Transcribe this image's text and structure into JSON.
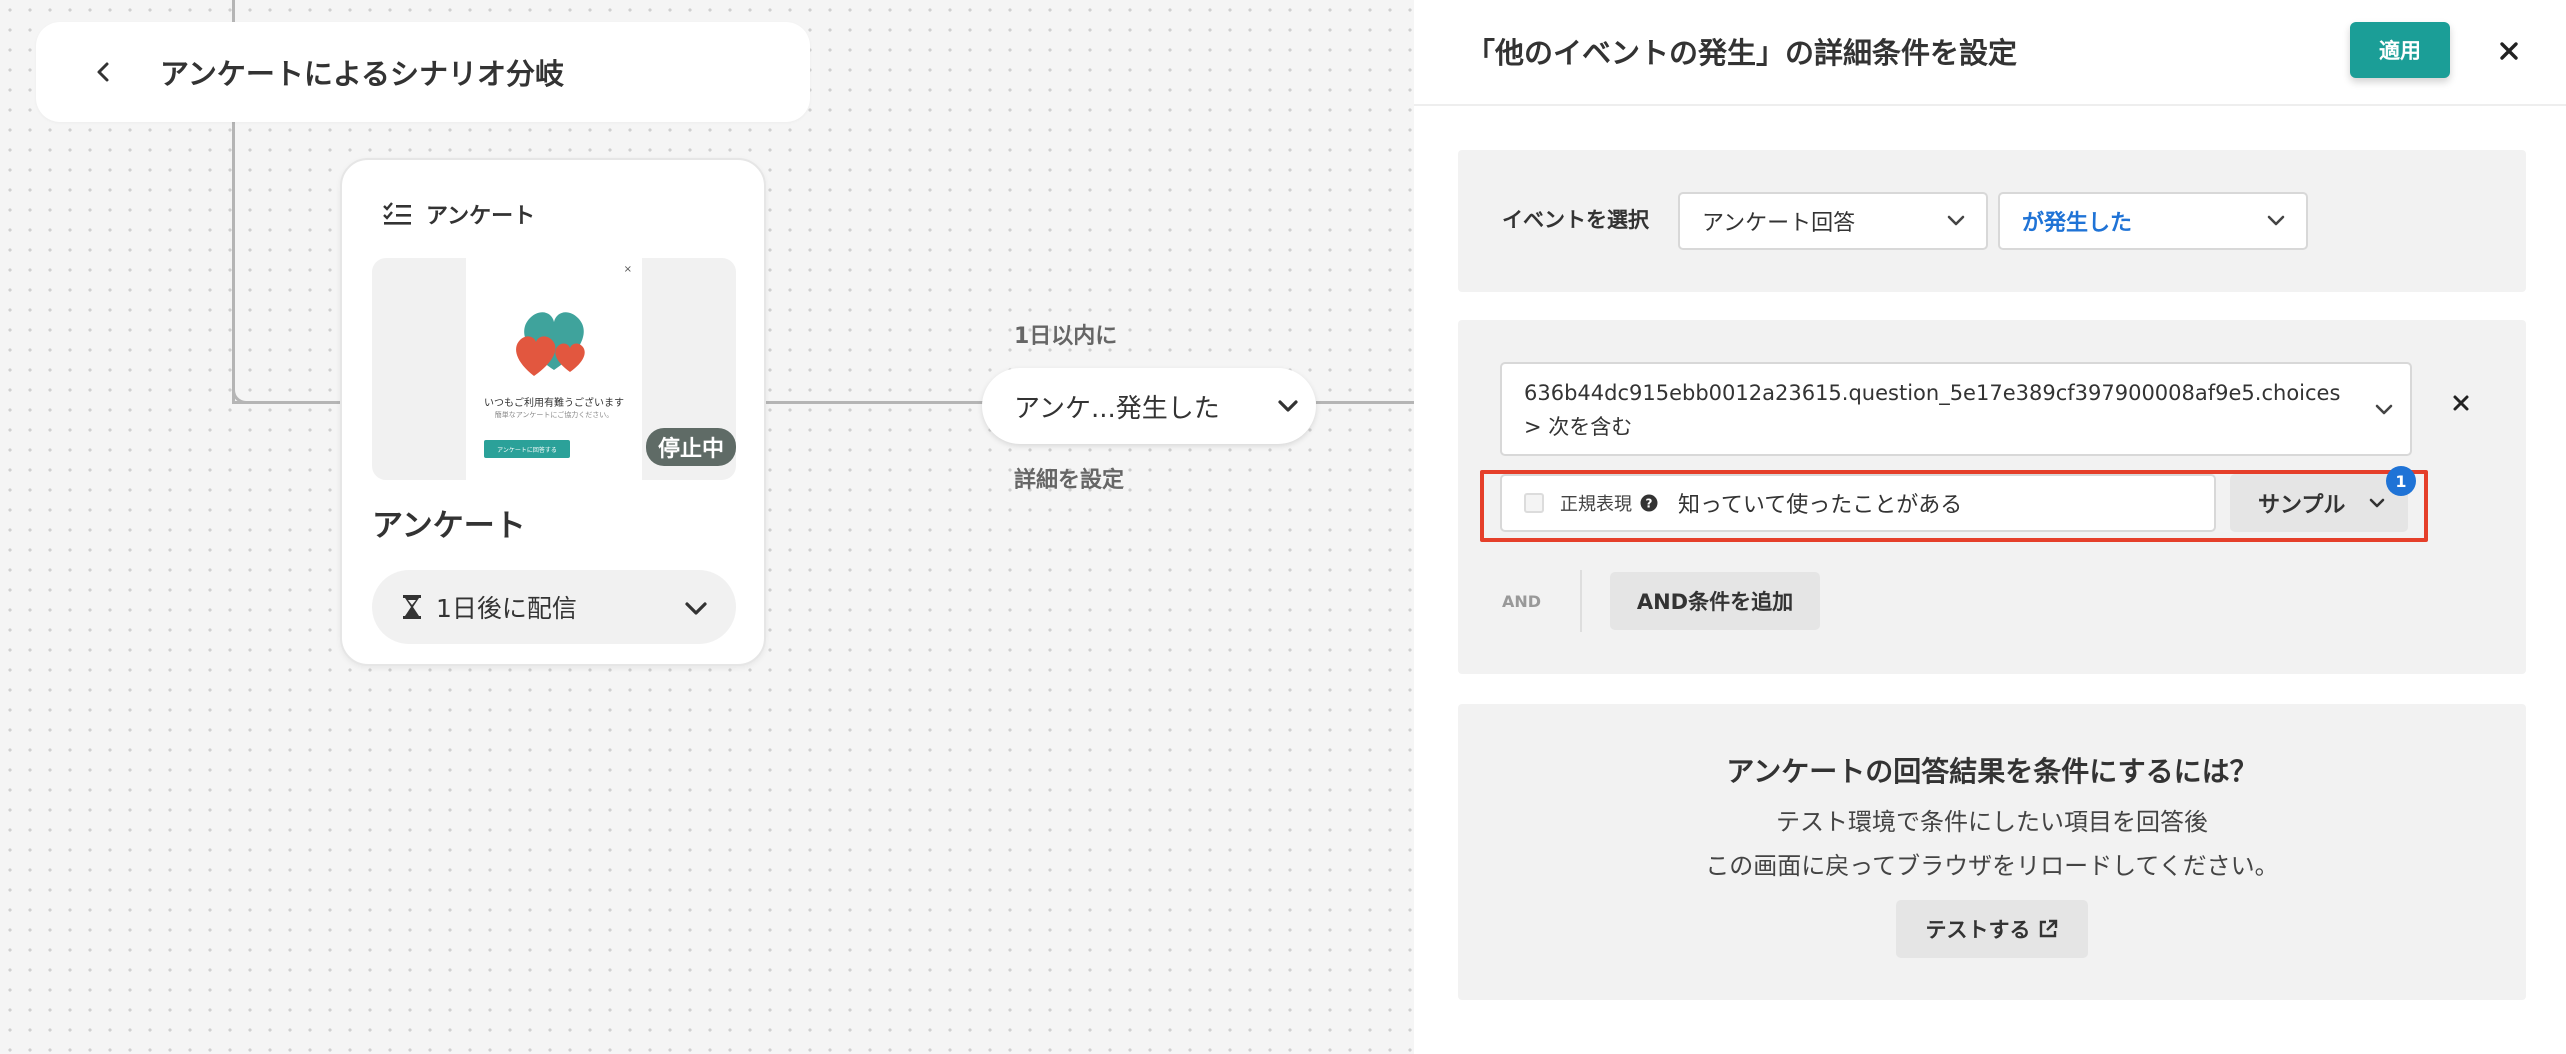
{
  "canvas": {
    "header": {
      "title": "アンケートによるシナリオ分岐",
      "back_icon": "chevron-left-icon"
    },
    "node": {
      "type_label": "アンケート",
      "type_icon": "checklist-icon",
      "preview": {
        "close_glyph": "×",
        "message": "いつもご利用有難うございます",
        "sub_message": "簡単なアンケートにご協力ください。",
        "button_label": "アンケートに回答する"
      },
      "status_badge": "停止中",
      "name": "アンケート",
      "delivery_label": "1日後に配信",
      "delivery_icon": "hourglass-icon"
    },
    "edge": {
      "top_label": "1日以内に",
      "pill_label": "アンケ...発生した",
      "bottom_label": "詳細を設定"
    }
  },
  "panel": {
    "title": "「他のイベントの発生」の詳細条件を設定",
    "apply_label": "適用",
    "close_icon": "close-icon",
    "event_section": {
      "label": "イベントを選択",
      "event_value": "アンケート回答",
      "occurrence_value": "が発生した"
    },
    "condition": {
      "field_text": "636b44dc915ebb0012a23615.question_5e17e389cf397900008af9e5.choices > 次を含む",
      "regex_label": "正規表現",
      "regex_checked": false,
      "value": "知っていて使ったことがある",
      "sample_label": "サンプル",
      "sample_count": "1",
      "and_label": "AND",
      "add_and_label": "AND条件を追加"
    },
    "tip": {
      "title": "アンケートの回答結果を条件にするには？",
      "line1": "テスト環境で条件にしたい項目を回答後",
      "line2": "この画面に戻ってブラウザをリロードしてください。",
      "test_label": "テストする"
    }
  },
  "colors": {
    "accent": "#1b9e97",
    "link_blue": "#1f73d6",
    "highlight_red": "#e53f2a",
    "badge_dark": "#5f6b66"
  }
}
